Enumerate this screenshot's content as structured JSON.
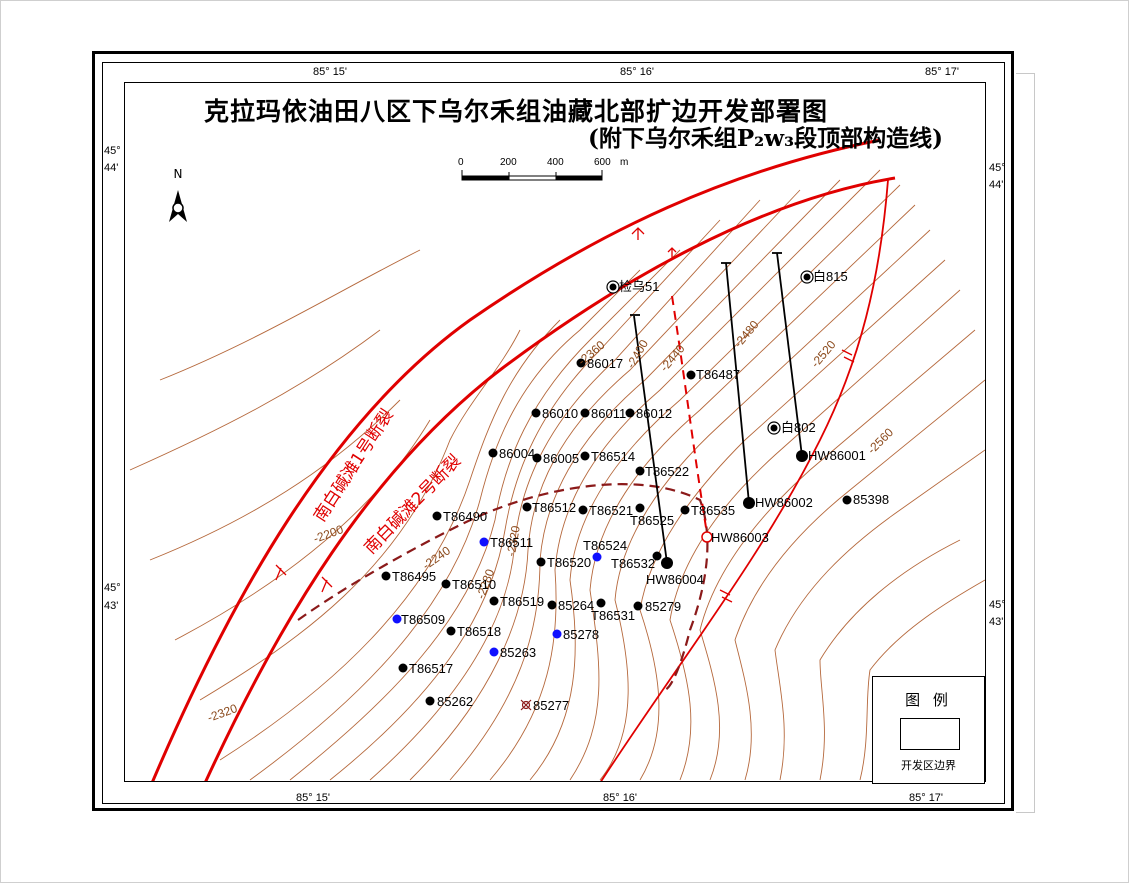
{
  "title": "克拉玛依油田八区下乌尔禾组油藏北部扩边开发部署图",
  "subtitle": "(附下乌尔禾组P₂w₃段顶部构造线)",
  "coords": {
    "top_left": "85° 15'",
    "top_mid": "85° 16'",
    "top_right": "85° 17'",
    "bottom_left": "85° 15'",
    "bottom_mid": "85° 16'",
    "bottom_right": "85° 17'",
    "left_upper_a": "45°",
    "left_upper_b": "44'",
    "left_lower_a": "45°",
    "left_lower_b": "43'",
    "right_upper_a": "45°",
    "right_upper_b": "44'",
    "right_lower_a": "45°",
    "right_lower_b": "43'"
  },
  "north_label": "N",
  "scale": {
    "ticks": [
      "0",
      "200",
      "400",
      "600"
    ],
    "unit": "m"
  },
  "faults": {
    "fault1": "南白碱滩1号断裂",
    "fault2": "南白碱滩2号断裂"
  },
  "contour_labels": [
    "-2360",
    "-2400",
    "-2440",
    "-2480",
    "-2520",
    "-2560",
    "-2200",
    "-2240",
    "-2280",
    "-2320",
    "-2320"
  ],
  "wells": [
    {
      "name": "检乌51",
      "type": "exploration"
    },
    {
      "name": "白815",
      "type": "exploration"
    },
    {
      "name": "白802",
      "type": "exploration"
    },
    {
      "name": "86017",
      "type": "oil"
    },
    {
      "name": "T86487",
      "type": "oil"
    },
    {
      "name": "86010",
      "type": "oil"
    },
    {
      "name": "86011",
      "type": "oil"
    },
    {
      "name": "86012",
      "type": "oil"
    },
    {
      "name": "86004",
      "type": "oil"
    },
    {
      "name": "86005",
      "type": "oil"
    },
    {
      "name": "T86514",
      "type": "oil"
    },
    {
      "name": "T86522",
      "type": "oil"
    },
    {
      "name": "HW86001",
      "type": "horizontal"
    },
    {
      "name": "85398",
      "type": "oil"
    },
    {
      "name": "HW86002",
      "type": "horizontal"
    },
    {
      "name": "T86512",
      "type": "oil"
    },
    {
      "name": "T86521",
      "type": "oil"
    },
    {
      "name": "T86525",
      "type": "oil"
    },
    {
      "name": "T86535",
      "type": "oil"
    },
    {
      "name": "HW86003",
      "type": "planned"
    },
    {
      "name": "T86490",
      "type": "oil"
    },
    {
      "name": "T86511",
      "type": "water"
    },
    {
      "name": "T86524",
      "type": "water"
    },
    {
      "name": "T86520",
      "type": "oil"
    },
    {
      "name": "T86532",
      "type": "oil"
    },
    {
      "name": "HW86004",
      "type": "horizontal"
    },
    {
      "name": "T86495",
      "type": "oil"
    },
    {
      "name": "T86510",
      "type": "oil"
    },
    {
      "name": "T86519",
      "type": "oil"
    },
    {
      "name": "85264",
      "type": "oil"
    },
    {
      "name": "T86531",
      "type": "oil"
    },
    {
      "name": "85279",
      "type": "oil"
    },
    {
      "name": "T86509",
      "type": "water"
    },
    {
      "name": "T86518",
      "type": "oil"
    },
    {
      "name": "85278",
      "type": "water"
    },
    {
      "name": "85263",
      "type": "water"
    },
    {
      "name": "T86517",
      "type": "oil"
    },
    {
      "name": "85262",
      "type": "oil"
    },
    {
      "name": "85277",
      "type": "abandoned"
    }
  ],
  "legend": {
    "title": "图 例",
    "item_label": "开发区边界"
  },
  "colors": {
    "fault": "#e00000",
    "contour": "#a0522d",
    "boundary": "#8b1a1a",
    "oil_well": "#000000",
    "water_well": "#0000ff"
  }
}
